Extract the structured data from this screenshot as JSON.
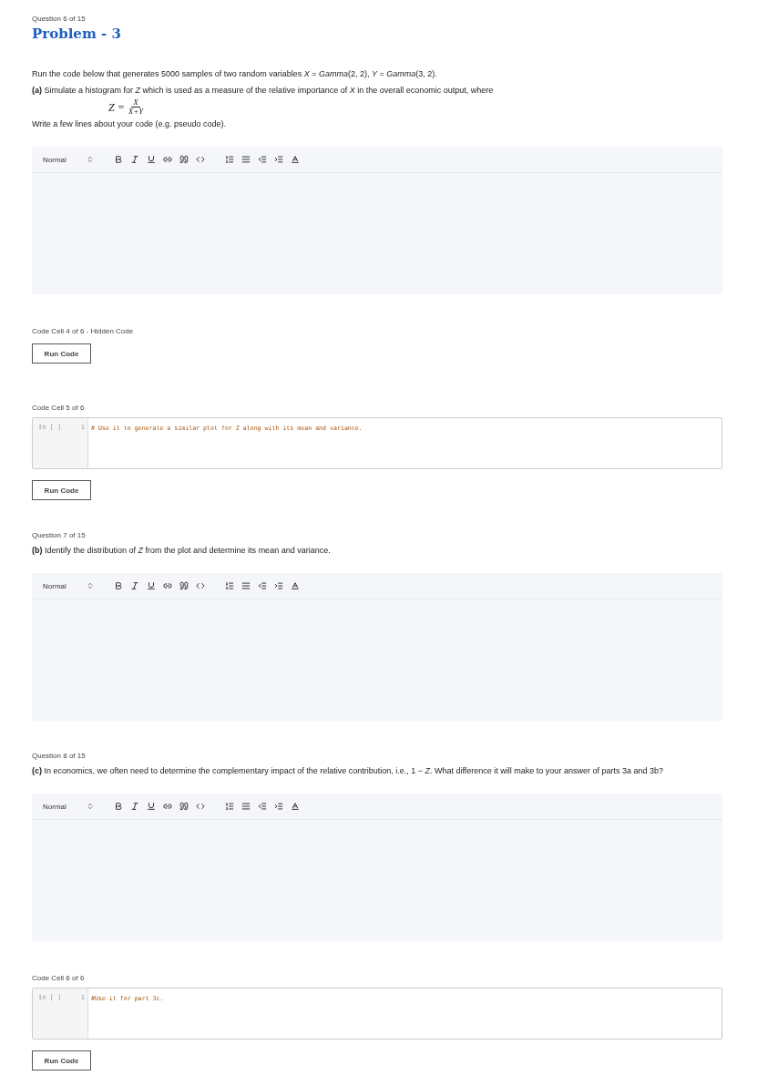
{
  "blocks": [
    {
      "kind": "question",
      "label": "Question 6 of 15",
      "title": "Problem - 3",
      "paragraphs": [
        {
          "kind": "text",
          "text": "Run the code below that generates 5000 samples of two random variables *X* = *Gamma*(2, 2),  *Y* = *Gamma*(3, 2)."
        },
        {
          "kind": "text",
          "text": "**(a)** Simulate a histogram for *Z* which is used as a measure of the relative importance of *X*  in the overall economic output, where"
        },
        {
          "kind": "fraction",
          "lhs": "Z =",
          "numerator": "X",
          "denominator": "X+Y"
        },
        {
          "kind": "text",
          "text": "Write a few lines about your code (e.g. pseudo code)."
        }
      ]
    },
    {
      "kind": "editor",
      "format": "Normal"
    },
    {
      "kind": "code",
      "label": "Code Cell 4 of 6 - Hidden Code",
      "button": "Run Code"
    },
    {
      "kind": "code",
      "label": "Code Cell 5 of 6",
      "prompt": "In [ ]",
      "lines": [
        {
          "number": "1",
          "text": "# Use it to generate a similar plot for Z along with its mean and variance."
        }
      ],
      "button": "Run Code"
    },
    {
      "kind": "question",
      "label": "Question 7 of 15",
      "paragraphs": [
        {
          "kind": "text",
          "text": "**(b)** Identify the distribution of *Z* from the plot and determine its mean and variance."
        }
      ]
    },
    {
      "kind": "editor",
      "format": "Normal"
    },
    {
      "kind": "question",
      "label": "Question 8 of 15",
      "paragraphs": [
        {
          "kind": "text",
          "text": "**(c)** In economics, we often need to determine the complementary impact of the relative contribution, i.e., 1 − *Z*. What difference it will make to your answer of parts 3a and 3b?"
        }
      ]
    },
    {
      "kind": "editor",
      "format": "Normal"
    },
    {
      "kind": "code",
      "label": "Code Cell 6 of 6",
      "prompt": "In [ ]",
      "lines": [
        {
          "number": "1",
          "text": "#Use it for part 3c."
        }
      ],
      "button": "Run Code"
    }
  ]
}
